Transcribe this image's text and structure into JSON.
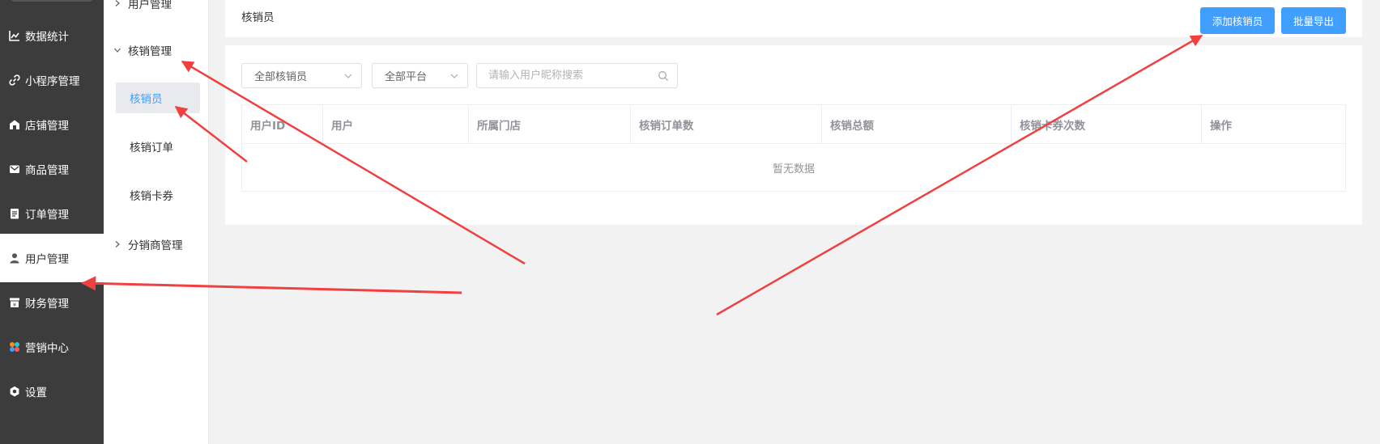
{
  "sidebar": {
    "items": [
      {
        "label": "数据统计",
        "icon": "line-chart-icon"
      },
      {
        "label": "小程序管理",
        "icon": "link-icon"
      },
      {
        "label": "店铺管理",
        "icon": "store-icon"
      },
      {
        "label": "商品管理",
        "icon": "envelope-icon"
      },
      {
        "label": "订单管理",
        "icon": "clipboard-icon"
      },
      {
        "label": "用户管理",
        "icon": "user-icon",
        "active": true
      },
      {
        "label": "财务管理",
        "icon": "finance-icon"
      },
      {
        "label": "营销中心",
        "icon": "marketing-icon"
      },
      {
        "label": "设置",
        "icon": "gear-icon"
      }
    ]
  },
  "submenu": {
    "group_user": "用户管理",
    "group_verify": "核销管理",
    "items": [
      {
        "label": "核销员",
        "active": true
      },
      {
        "label": "核销订单"
      },
      {
        "label": "核销卡券"
      }
    ],
    "group_distributor": "分销商管理"
  },
  "header": {
    "title": "核销员",
    "add_button": "添加核销员",
    "export_button": "批量导出"
  },
  "filters": {
    "verifier_select": "全部核销员",
    "platform_select": "全部平台",
    "search_placeholder": "请输入用户昵称搜索"
  },
  "table": {
    "columns": [
      "用户ID",
      "用户",
      "所属门店",
      "核销订单数",
      "核销总额",
      "核销卡券次数",
      "操作"
    ],
    "empty_text": "暂无数据"
  },
  "colors": {
    "sidebar_bg": "#3c3c3c",
    "primary": "#409eff",
    "annotation_arrow": "#f04040"
  }
}
